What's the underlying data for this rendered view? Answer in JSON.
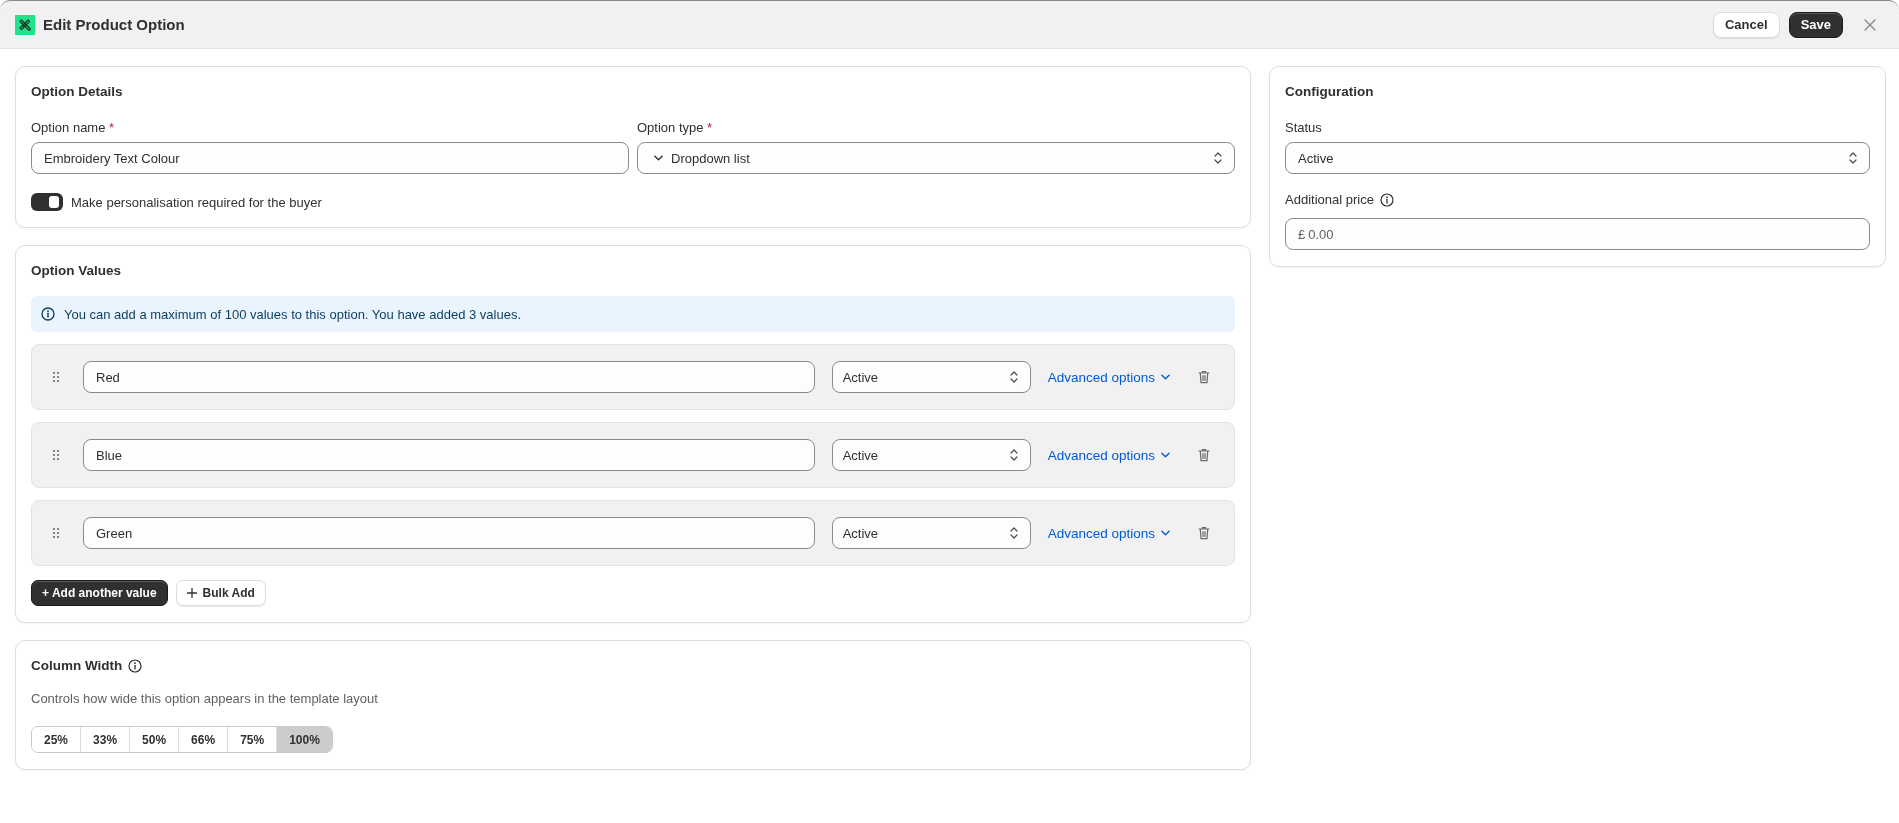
{
  "header": {
    "title": "Edit Product Option",
    "buttons": [
      {
        "label": "Cancel",
        "kind": "secondary"
      },
      {
        "label": "Save",
        "kind": "primary"
      }
    ]
  },
  "option_details": {
    "title": "Option Details",
    "fields": [
      {
        "kind": "text",
        "label": "Option name",
        "required_mark": "*",
        "value": "Embroidery Text Colour"
      },
      {
        "kind": "select",
        "label": "Option type",
        "required_mark": "*",
        "value": "Dropdown list"
      }
    ],
    "toggle": {
      "label": "Make personalisation required for the buyer",
      "on": true
    }
  },
  "option_values": {
    "title": "Option Values",
    "info": "You can add a maximum of 100 values to this option. You have added 3 values.",
    "rows": [
      {
        "value": "Red",
        "status": "Active",
        "link": "Advanced options"
      },
      {
        "value": "Blue",
        "status": "Active",
        "link": "Advanced options"
      },
      {
        "value": "Green",
        "status": "Active",
        "link": "Advanced options"
      }
    ],
    "buttons": [
      {
        "label": "+ Add another value",
        "kind": "primary"
      },
      {
        "label": "Bulk Add",
        "kind": "secondary"
      }
    ]
  },
  "column_width": {
    "title": "Column Width",
    "description": "Controls how wide this option appears in the template layout",
    "options": [
      {
        "label": "25%",
        "selected": false
      },
      {
        "label": "33%",
        "selected": false
      },
      {
        "label": "50%",
        "selected": false
      },
      {
        "label": "66%",
        "selected": false
      },
      {
        "label": "75%",
        "selected": false
      },
      {
        "label": "100%",
        "selected": true
      }
    ]
  },
  "configuration": {
    "title": "Configuration",
    "status": {
      "label": "Status",
      "value": "Active"
    },
    "additional_price": {
      "label": "Additional price",
      "currency": "£",
      "value": "0.00"
    }
  }
}
